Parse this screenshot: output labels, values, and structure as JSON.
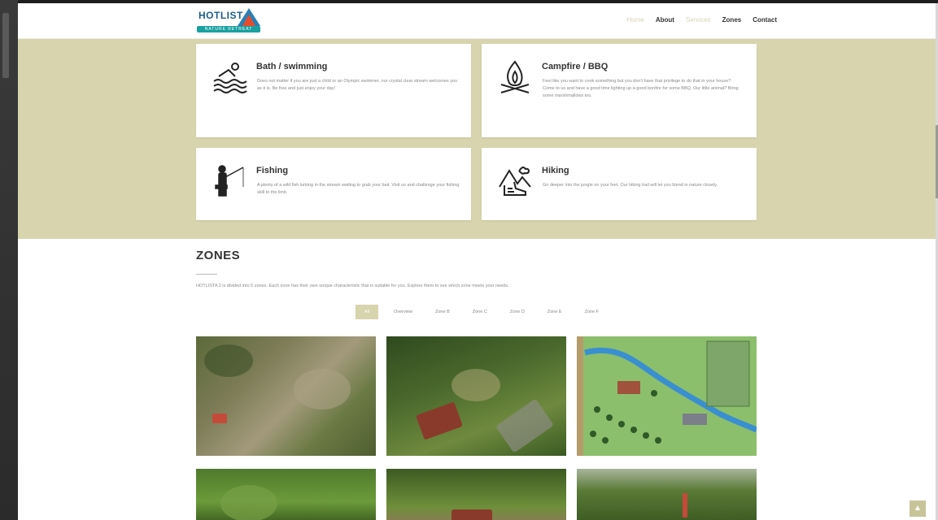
{
  "header": {
    "logo": {
      "name": "HOTLIST",
      "tagline": "NATURE RETREAT"
    },
    "nav": [
      {
        "label": "Home",
        "state": "inactive"
      },
      {
        "label": "About",
        "state": "active"
      },
      {
        "label": "Services",
        "state": "inactive"
      },
      {
        "label": "Zones",
        "state": "active"
      },
      {
        "label": "Contact",
        "state": "active"
      }
    ]
  },
  "services": [
    {
      "title": "Bath / swimming",
      "icon": "swimming-icon",
      "text": "Does not matter if you are just a child or an Olympic swimmer, our crystal clear stream welcomes you as it is. Be free and just enjoy your day!"
    },
    {
      "title": "Campfire / BBQ",
      "icon": "campfire-icon",
      "text": "Feel like you want to cook something but you don't have that privilege to do that in your house? Come to us and have a good time lighting up a good bonfire for some BBQ. Our little animal? Bring some marshmallows too."
    },
    {
      "title": "Fishing",
      "icon": "fishing-icon",
      "text": "A plenty of a wild fish lurking in the stream waiting to grab your bait. Visit us and challenge your fishing skill to the limit."
    },
    {
      "title": "Hiking",
      "icon": "hiking-icon",
      "text": "Go deeper into the jungle on your feet. Our hiking trail will let you blend in nature closely."
    }
  ],
  "zones": {
    "title": "ZONES",
    "description": "HOTLISTA 2 is divided into 5 zones. Each zone has their own unique characteristic that is suitable for you. Explore them to see which zone meets your needs.",
    "filters": [
      "All",
      "Overview",
      "Zone B",
      "Zone C",
      "Zone D",
      "Zone E",
      "Zone F"
    ],
    "active_filter": "All"
  },
  "colors": {
    "accent": "#d8d4ad",
    "heading": "#333333",
    "text_muted": "#888888"
  },
  "scroll_top_icon": "arrow-up-icon"
}
